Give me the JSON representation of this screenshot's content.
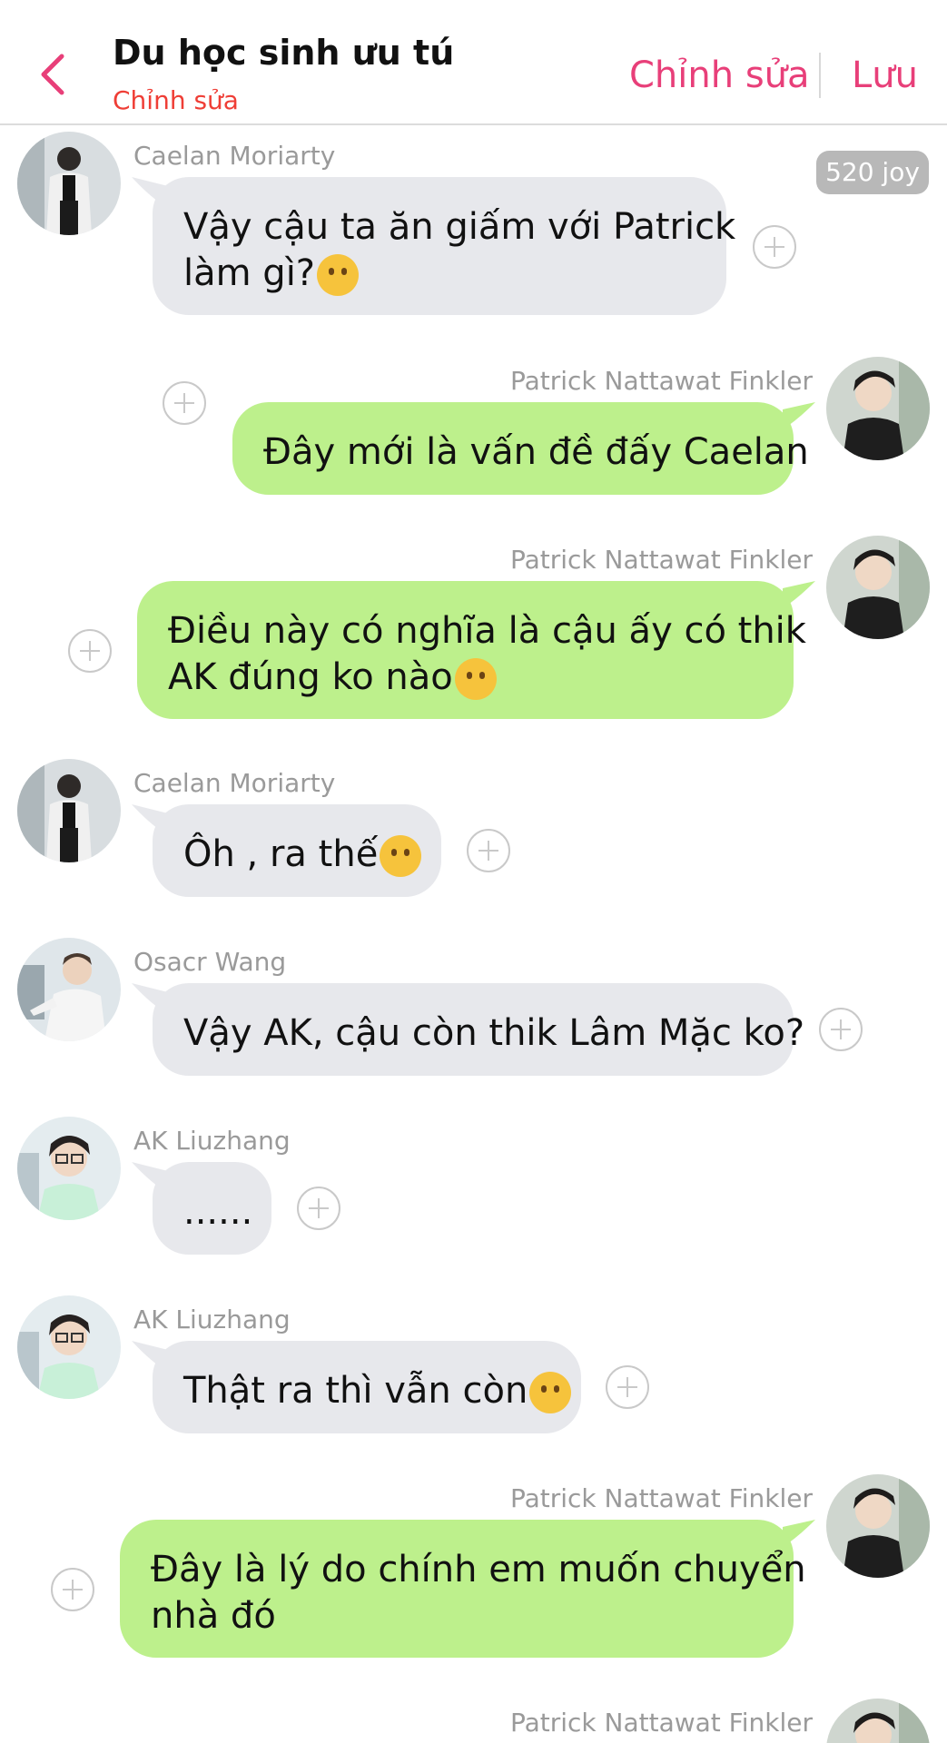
{
  "header": {
    "title": "Du học sinh ưu tú",
    "subtitle": "Chỉnh sửa",
    "edit_label": "Chỉnh sửa",
    "save_label": "Lưu",
    "accent_color": "#e83f79"
  },
  "badge": {
    "text": "520 joy"
  },
  "messages": [
    {
      "sender": "Caelan Moriarty",
      "side": "left",
      "text": "Vậy cậu ta ăn giấm với Patrick",
      "text2": "làm gì?",
      "emoji": "thinking-face"
    },
    {
      "sender": "Patrick Nattawat Finkler",
      "side": "right",
      "text": "Đây mới là vấn đề đấy Caelan"
    },
    {
      "sender": "Patrick Nattawat Finkler",
      "side": "right",
      "text": "Điều này có nghĩa là cậu ấy có thik",
      "text2": "AK đúng ko nào",
      "emoji": "ok-hand"
    },
    {
      "sender": "Caelan Moriarty",
      "side": "left",
      "text": "Ôh , ra thế",
      "emoji": "clapping-hands"
    },
    {
      "sender": "Osacr Wang",
      "side": "left",
      "text": "Vậy AK, cậu còn thik Lâm Mặc ko?"
    },
    {
      "sender": "AK Liuzhang",
      "side": "left",
      "text": "......"
    },
    {
      "sender": "AK Liuzhang",
      "side": "left",
      "text": "Thật ra thì vẫn còn",
      "emoji": "upside-down-face"
    },
    {
      "sender": "Patrick Nattawat Finkler",
      "side": "right",
      "text": "Đây là lý do chính em muốn chuyển",
      "text2": "nhà đó"
    },
    {
      "sender": "Patrick Nattawat Finkler",
      "side": "right"
    }
  ],
  "colors": {
    "incoming_bubble": "#e7e8ec",
    "outgoing_bubble": "#bdf08c",
    "subtitle": "#ef3e36"
  }
}
